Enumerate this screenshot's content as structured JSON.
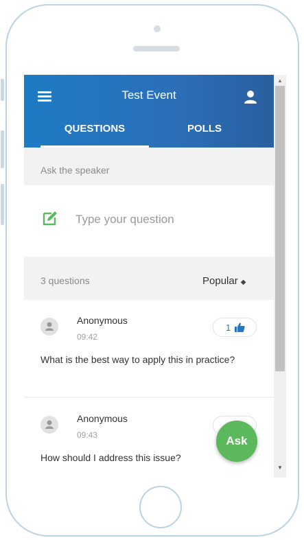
{
  "header": {
    "title": "Test Event",
    "tabs": [
      {
        "label": "QUESTIONS",
        "active": true
      },
      {
        "label": "POLLS",
        "active": false
      }
    ]
  },
  "ask": {
    "label": "Ask the speaker",
    "placeholder": "Type your question"
  },
  "list": {
    "count_label": "3 questions",
    "sort_label": "Popular"
  },
  "questions": [
    {
      "author": "Anonymous",
      "time": "09:42",
      "text": "What is the best way to apply this in practice?",
      "likes": "1"
    },
    {
      "author": "Anonymous",
      "time": "09:43",
      "text": "How should I address this issue?",
      "likes": ""
    }
  ],
  "fab": {
    "label": "Ask"
  },
  "colors": {
    "header": "#1e7bc4",
    "accent_green": "#5cb85c",
    "like_blue": "#2b74c0"
  },
  "icons": [
    "menu-icon",
    "user-icon",
    "edit-icon",
    "sort-icon",
    "avatar-icon",
    "thumbs-up-icon"
  ]
}
